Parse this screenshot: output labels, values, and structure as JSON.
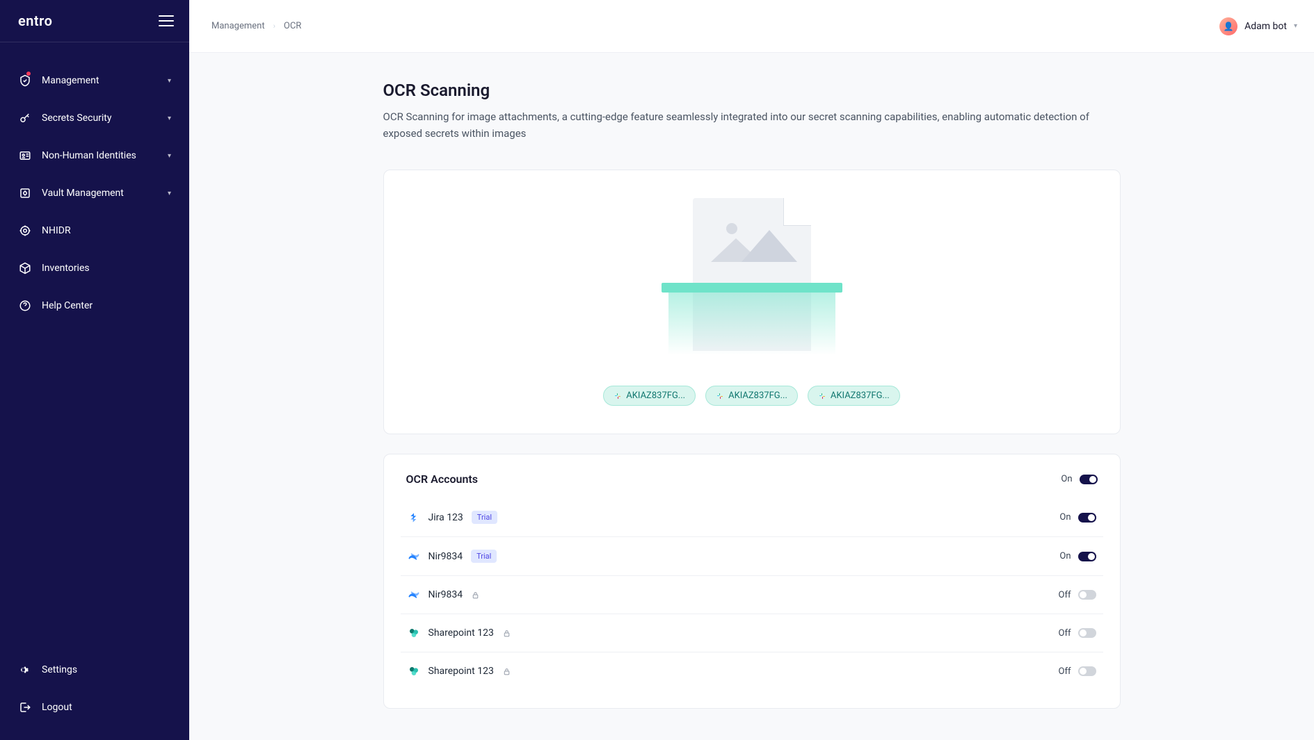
{
  "brand": "entro",
  "breadcrumb": {
    "root": "Management",
    "current": "OCR"
  },
  "user": {
    "name": "Adam bot"
  },
  "sidebar": {
    "items": [
      {
        "label": "Management",
        "has_chevron": true,
        "has_dot": true,
        "icon": "shield"
      },
      {
        "label": "Secrets Security",
        "has_chevron": true,
        "icon": "key"
      },
      {
        "label": "Non-Human Identities",
        "has_chevron": true,
        "icon": "id"
      },
      {
        "label": "Vault Management",
        "has_chevron": true,
        "icon": "vault"
      },
      {
        "label": "NHIDR",
        "has_chevron": false,
        "icon": "target"
      },
      {
        "label": "Inventories",
        "has_chevron": false,
        "icon": "box"
      },
      {
        "label": "Help Center",
        "has_chevron": false,
        "icon": "help"
      }
    ],
    "bottom": [
      {
        "label": "Settings",
        "icon": "gear"
      },
      {
        "label": "Logout",
        "icon": "logout"
      }
    ]
  },
  "page": {
    "title": "OCR Scanning",
    "description": "OCR Scanning for image attachments, a cutting-edge feature seamlessly integrated into our secret scanning capabilities, enabling automatic detection of exposed secrets within images"
  },
  "chips": [
    {
      "label": "AKIAZ837FG..."
    },
    {
      "label": "AKIAZ837FG..."
    },
    {
      "label": "AKIAZ837FG..."
    }
  ],
  "accounts": {
    "title": "OCR Accounts",
    "master_toggle": {
      "state": "On",
      "on": true
    },
    "rows": [
      {
        "name": "Jira 123",
        "icon": "jira",
        "badge": "Trial",
        "locked": false,
        "state": "On",
        "on": true
      },
      {
        "name": "Nir9834",
        "icon": "confluence",
        "badge": "Trial",
        "locked": false,
        "state": "On",
        "on": true
      },
      {
        "name": "Nir9834",
        "icon": "confluence",
        "badge": null,
        "locked": true,
        "state": "Off",
        "on": false
      },
      {
        "name": "Sharepoint 123",
        "icon": "sharepoint",
        "badge": null,
        "locked": true,
        "state": "Off",
        "on": false
      },
      {
        "name": "Sharepoint 123",
        "icon": "sharepoint",
        "badge": null,
        "locked": true,
        "state": "Off",
        "on": false
      }
    ]
  }
}
